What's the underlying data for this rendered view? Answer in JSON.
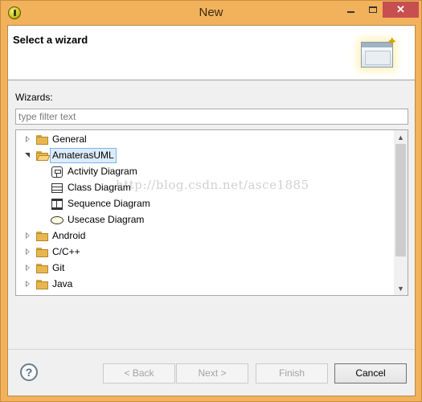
{
  "window": {
    "title": "New",
    "close_glyph": "✕"
  },
  "header": {
    "title": "Select a wizard"
  },
  "wizards_label": "Wizards:",
  "filter": {
    "placeholder": "type filter text",
    "value": ""
  },
  "tree": {
    "items": [
      {
        "label": "General",
        "expanded": false,
        "icon": "folder-icon"
      },
      {
        "label": "AmaterasUML",
        "expanded": true,
        "selected": true,
        "icon": "folder-open-icon",
        "children": [
          {
            "label": "Activity Diagram",
            "icon": "activity-diagram-icon"
          },
          {
            "label": "Class Diagram",
            "icon": "class-diagram-icon"
          },
          {
            "label": "Sequence Diagram",
            "icon": "sequence-diagram-icon"
          },
          {
            "label": "Usecase Diagram",
            "icon": "usecase-diagram-icon"
          }
        ]
      },
      {
        "label": "Android",
        "expanded": false,
        "icon": "folder-icon"
      },
      {
        "label": "C/C++",
        "expanded": false,
        "icon": "folder-icon"
      },
      {
        "label": "Git",
        "expanded": false,
        "icon": "folder-icon"
      },
      {
        "label": "Java",
        "expanded": false,
        "icon": "folder-icon"
      }
    ]
  },
  "watermark": "http://blog.csdn.net/asce1885",
  "buttons": {
    "help": "?",
    "back": "< Back",
    "next": "Next >",
    "finish": "Finish",
    "cancel": "Cancel"
  },
  "scrollbar": {
    "up": "▲",
    "down": "▼"
  },
  "colors": {
    "frame": "#f2b25c",
    "selection": "#dcecfc",
    "close_button": "#c74f4f"
  }
}
